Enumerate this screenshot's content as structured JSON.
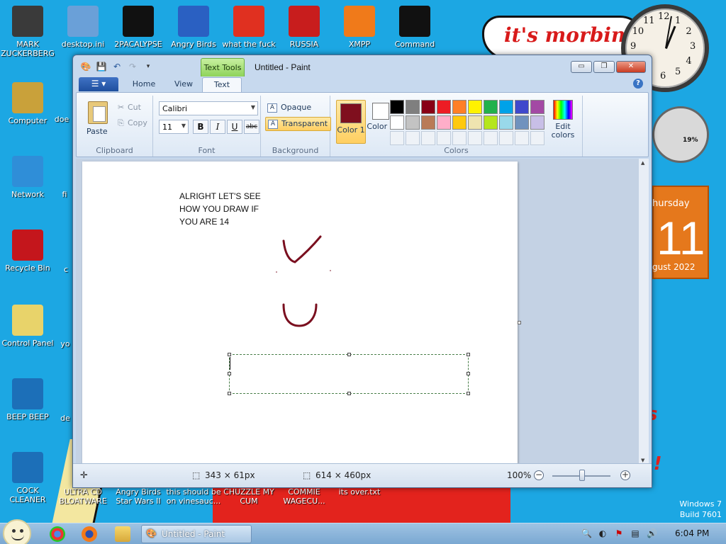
{
  "desktop": {
    "icons": [
      {
        "label": "MARK ZUCKERBERG",
        "color": "#3a3a3a"
      },
      {
        "label": "desktop.ini",
        "color": "#6aa0d8"
      },
      {
        "label": "2PACALYPSE",
        "color": "#111111"
      },
      {
        "label": "Angry Birds",
        "color": "#2a60c2"
      },
      {
        "label": "what the fuck",
        "color": "#e03020"
      },
      {
        "label": "RUSSIA",
        "color": "#c81d1d"
      },
      {
        "label": "XMPP",
        "color": "#f07a1a"
      },
      {
        "label": "Command",
        "color": "#111111"
      },
      {
        "label": "Computer",
        "color": "#c9a13a"
      },
      {
        "label": "Network",
        "color": "#2f8ed8"
      },
      {
        "label": "Recycle Bin",
        "color": "#c4161c"
      },
      {
        "label": "Control Panel",
        "color": "#e8d36a"
      },
      {
        "label": "BEEP BEEP",
        "color": "#1c6fb8"
      },
      {
        "label": "COCK CLEANER",
        "color": "#1c6fb8"
      }
    ],
    "partial_labels": [
      "doe",
      "fi",
      "c",
      "yo",
      "de"
    ],
    "bottom_labels": [
      "ULTRA CD BLOATWARE",
      "Angry Birds Star Wars II",
      "this should be on vinesauc...",
      "CHUZZLE MY CUM",
      "COMMIE WAGECU...",
      "its over.txt"
    ],
    "morbin_text": "it's morbin",
    "clock_numbers": [
      "12",
      "1",
      "2",
      "3",
      "4",
      "5",
      "6",
      "7",
      "8",
      "9",
      "10",
      "11"
    ],
    "meter_value": "19%",
    "calendar": {
      "day": "hursday",
      "number": "11",
      "month": "gust 2022"
    },
    "watermark": {
      "line1": "Windows 7",
      "line2": "Build 7601"
    },
    "red_words": [
      "s",
      "!!!"
    ]
  },
  "paint": {
    "title": "Untitled - Paint",
    "contextual_tab": "Text Tools",
    "window_buttons": {
      "minimize": "▭",
      "maximize": "❐",
      "close": "✕"
    },
    "tabs": [
      "Home",
      "View",
      "Text"
    ],
    "active_tab": "Text",
    "help": "?",
    "clipboard": {
      "paste": "Paste",
      "cut": "Cut",
      "copy": "Copy",
      "label": "Clipboard"
    },
    "font": {
      "family": "Calibri",
      "size": "11",
      "bold": "B",
      "italic": "I",
      "underline": "U",
      "strike": "abc",
      "label": "Font"
    },
    "background": {
      "opaque": "Opaque",
      "transparent": "Transparent",
      "label": "Background"
    },
    "colors": {
      "color1_label": "Color 1",
      "color2_label": "Color 2",
      "color1": "#7f0f1e",
      "color2": "#ffffff",
      "edit_label": "Edit colors",
      "label": "Colors",
      "palette": [
        "#000000",
        "#7f7f7f",
        "#880015",
        "#ed1c24",
        "#ff7f27",
        "#fff200",
        "#22b14c",
        "#00a2e8",
        "#3f48cc",
        "#a349a4",
        "#ffffff",
        "#c3c3c3",
        "#b97a57",
        "#ffaec9",
        "#ffc90e",
        "#efe4b0",
        "#b5e61d",
        "#99d9ea",
        "#7092be",
        "#c8bfe7"
      ]
    },
    "canvas_text": "ALRIGHT LET'S SEE\nHOW YOU DRAW IF\nYOU ARE 14",
    "drawing_color": "#7a0f1f",
    "status": {
      "selection_size": "343 × 61px",
      "canvas_size": "614 × 460px",
      "zoom": "100%"
    }
  },
  "taskbar": {
    "task_label": "Untitled - Paint",
    "time": "6:04 PM"
  }
}
